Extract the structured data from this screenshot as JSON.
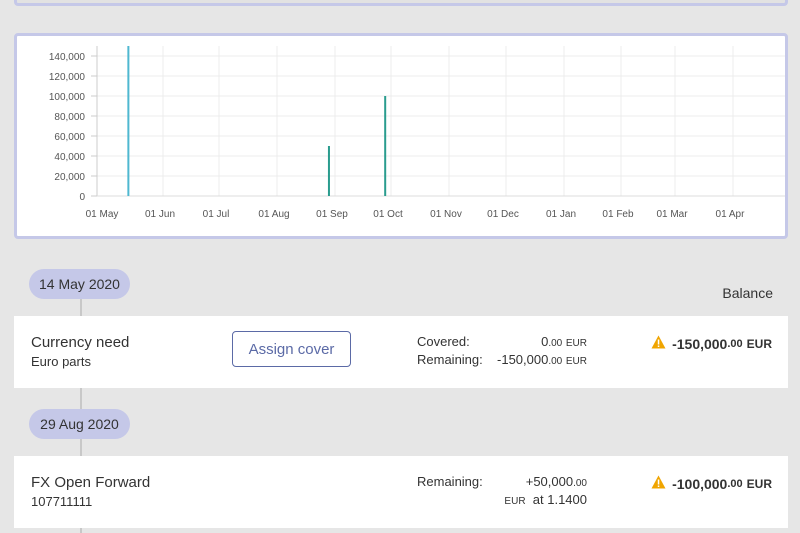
{
  "chart_data": {
    "type": "bar",
    "x_ticks": [
      "01 May",
      "01 Jun",
      "01 Jul",
      "01 Aug",
      "01 Sep",
      "01 Oct",
      "01 Nov",
      "01 Dec",
      "01 Jan",
      "01 Feb",
      "01 Mar",
      "01 Apr"
    ],
    "y_ticks": [
      "140,000",
      "120,000",
      "100,000",
      "80,000",
      "60,000",
      "40,000",
      "20,000",
      "0"
    ],
    "ylim": [
      0,
      150000
    ],
    "grid": true,
    "series": [
      {
        "x": "2020-05-14",
        "value": 150000,
        "color": "#4fb8d0"
      },
      {
        "x": "2020-08-29",
        "value": 50000,
        "color": "#2a9c8e"
      },
      {
        "x": "2020-09-28",
        "value": 100000,
        "color": "#2a9c8e"
      }
    ]
  },
  "balance_header": "Balance",
  "entries": [
    {
      "date": "14 May 2020",
      "title": "Currency need",
      "subtitle": "Euro parts",
      "button": "Assign cover",
      "covered_label": "Covered:",
      "covered_main": "0",
      "covered_dec": ".00",
      "covered_cur": "EUR",
      "remaining_label": "Remaining:",
      "remaining_main": "-150,000",
      "remaining_dec": ".00",
      "remaining_cur": "EUR",
      "balance_main": "-150,000",
      "balance_dec": ".00",
      "balance_cur": "EUR",
      "warning_color": "#f0a500"
    },
    {
      "date": "29 Aug 2020",
      "title": "FX Open Forward",
      "subtitle": "107711111",
      "remaining_label": "Remaining:",
      "remaining_main": "+50,000",
      "remaining_dec": ".00",
      "rate_cur": "EUR",
      "rate_text": "at 1.1400",
      "balance_main": "-100,000",
      "balance_dec": ".00",
      "balance_cur": "EUR",
      "warning_color": "#f0a500"
    }
  ]
}
